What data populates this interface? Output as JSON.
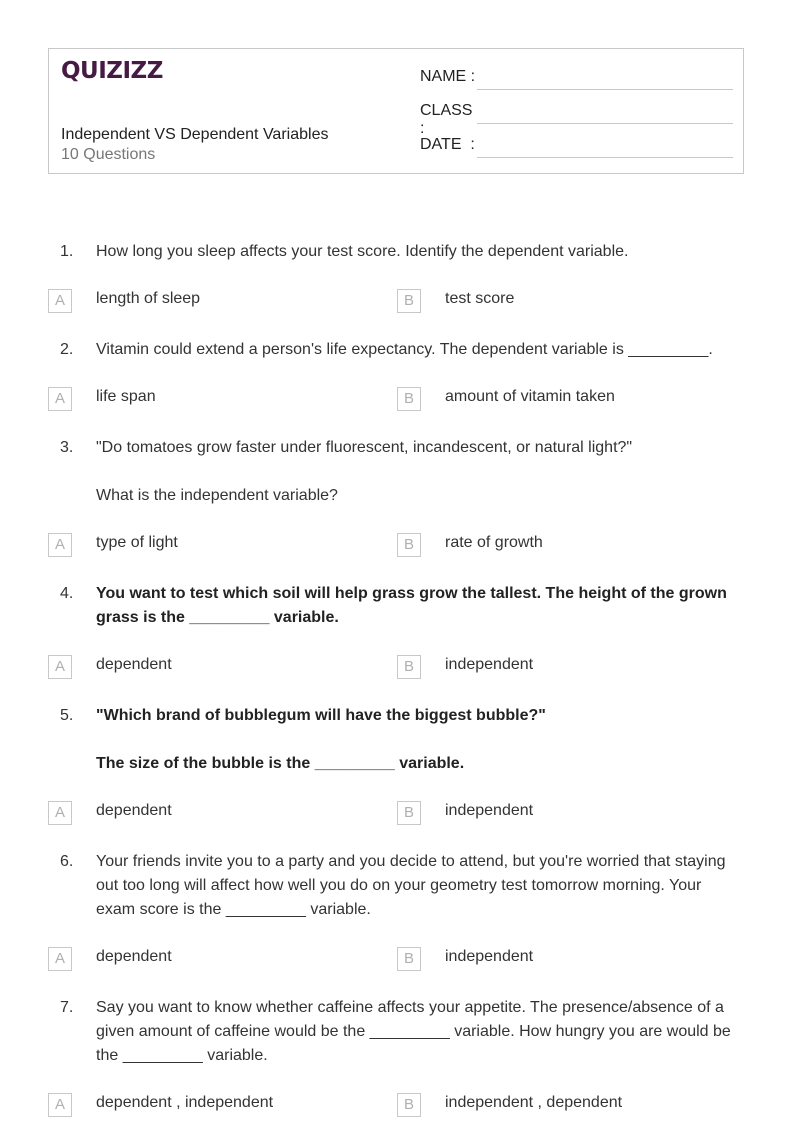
{
  "header": {
    "logo": "QUIZIZZ",
    "title": "Independent VS Dependent Variables",
    "question_count": "10 Questions",
    "fields": [
      {
        "label": "NAME :"
      },
      {
        "label": "CLASS :"
      },
      {
        "label": "DATE  :"
      }
    ]
  },
  "questions": [
    {
      "number": "1.",
      "paragraphs": [
        "How long you sleep affects your test score. Identify the dependent variable."
      ],
      "options": [
        {
          "letter": "A",
          "text": "length of sleep"
        },
        {
          "letter": "B",
          "text": "test score"
        }
      ]
    },
    {
      "number": "2.",
      "paragraphs": [
        "Vitamin could extend a person's life expectancy. The dependent variable is _________."
      ],
      "options": [
        {
          "letter": "A",
          "text": "life span"
        },
        {
          "letter": "B",
          "text": "amount of vitamin taken"
        }
      ]
    },
    {
      "number": "3.",
      "paragraphs": [
        "\"Do tomatoes grow faster under fluorescent, incandescent, or natural light?\"",
        "What is the independent variable?"
      ],
      "options": [
        {
          "letter": "A",
          "text": "type of light"
        },
        {
          "letter": "B",
          "text": "rate of growth"
        }
      ]
    },
    {
      "number": "4.",
      "paragraphs": [
        "You want to test which soil will help grass grow the tallest. The height of the grown grass is the _________ variable."
      ],
      "options": [
        {
          "letter": "A",
          "text": "dependent"
        },
        {
          "letter": "B",
          "text": "independent"
        }
      ]
    },
    {
      "number": "5.",
      "paragraphs": [
        "\"Which brand of bubblegum will have the biggest bubble?\"",
        "The size of the bubble is the _________ variable."
      ],
      "options": [
        {
          "letter": "A",
          "text": "dependent"
        },
        {
          "letter": "B",
          "text": "independent"
        }
      ]
    },
    {
      "number": "6.",
      "paragraphs": [
        "Your friends invite you to a party and you decide to attend, but you're worried that staying out too long will affect how well you do on your geometry test tomorrow morning. Your exam score is the _________ variable."
      ],
      "options": [
        {
          "letter": "A",
          "text": "dependent"
        },
        {
          "letter": "B",
          "text": "independent"
        }
      ]
    },
    {
      "number": "7.",
      "paragraphs": [
        "Say you want to know whether caffeine affects your appetite. The presence/absence of a given amount of caffeine would be the _________ variable. How hungry you are would be the _________ variable."
      ],
      "options": [
        {
          "letter": "A",
          "text": "dependent , independent"
        },
        {
          "letter": "B",
          "text": "independent , dependent"
        }
      ]
    }
  ]
}
